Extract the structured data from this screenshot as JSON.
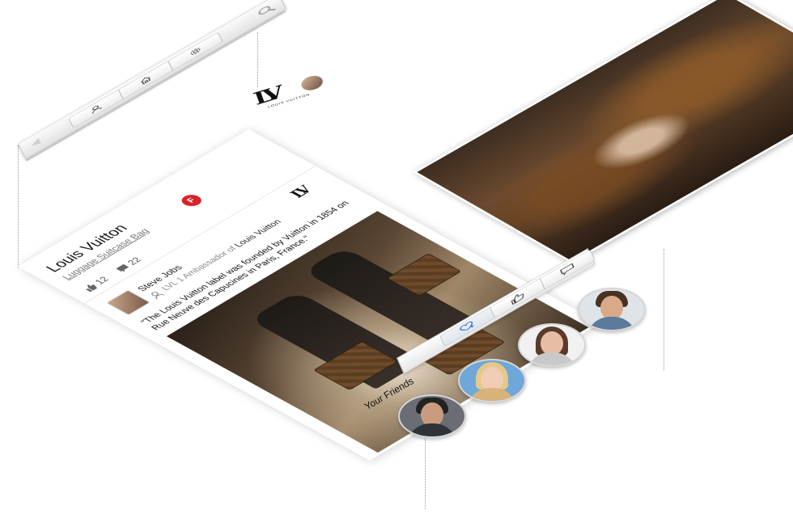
{
  "toolbar": {
    "back_icon": "back-arrow-icon",
    "tabs": [
      {
        "icon": "user-icon"
      },
      {
        "icon": "home-icon"
      },
      {
        "icon": "gear-icon"
      }
    ],
    "search_icon": "search-icon"
  },
  "brand": {
    "logo_text": "LV",
    "wordmark": "LOUIS VUITTON"
  },
  "product": {
    "title": "Louis Vuitton",
    "subtitle": "Luggage Suitcase Bag",
    "badge_icon": "foursquare-icon",
    "badge_text": "F",
    "likes": "12",
    "dislikes": "22"
  },
  "post": {
    "author": "Steve Jobs",
    "role_prefix": "LVL 1 Ambassador of",
    "role_brand": "Louis Vuitton",
    "quote": "\"The Louis Vuitton label was founded by Vuitton in 1854 on Rue Neuve des Capucines in Paris, France.\""
  },
  "actions": [
    {
      "icon": "heart-add-icon",
      "active": true
    },
    {
      "icon": "like-icon",
      "active": false
    },
    {
      "icon": "comment-icon",
      "active": false
    }
  ],
  "friends": {
    "label": "Your Friends",
    "items": [
      {
        "name": "friend-1"
      },
      {
        "name": "friend-2"
      },
      {
        "name": "friend-3"
      },
      {
        "name": "friend-4"
      }
    ]
  },
  "colors": {
    "badge_red": "#d8232a",
    "heart_blue": "#2a6fd6",
    "guide_gray": "#9a9a9a"
  }
}
